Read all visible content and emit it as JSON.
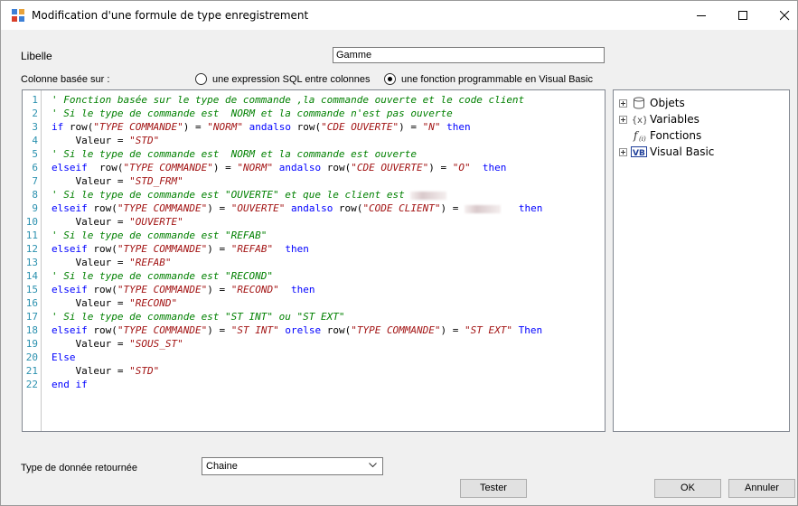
{
  "window": {
    "title": "Modification d'une formule de type enregistrement"
  },
  "form": {
    "libelle_label": "Libelle",
    "libelle_value": "Gamme",
    "colonne_label": "Colonne basée sur :",
    "radio_sql_label": "une expression SQL entre colonnes",
    "radio_vb_label": "une fonction programmable en Visual Basic",
    "radio_selected": "vb",
    "type_label": "Type de donnée retournée",
    "type_value": "Chaine"
  },
  "editor": {
    "line_numbers": [
      "1",
      "2",
      "3",
      "4",
      "5",
      "6",
      "7",
      "8",
      "9",
      "10",
      "11",
      "12",
      "13",
      "14",
      "15",
      "16",
      "17",
      "18",
      "19",
      "20",
      "21",
      "22"
    ],
    "lines": [
      [
        {
          "t": "' Fonction basée sur le type de commande ,la commande ouverte et le code client",
          "c": "comment"
        }
      ],
      [
        {
          "t": "' Si le type de commande est  NORM et la commande n'est pas ouverte",
          "c": "comment"
        }
      ],
      [
        {
          "t": "if",
          "c": "kw"
        },
        {
          "t": " row(",
          "c": "plain"
        },
        {
          "t": "\"TYPE COMMANDE\"",
          "c": "str"
        },
        {
          "t": ") = ",
          "c": "plain"
        },
        {
          "t": "\"NORM\"",
          "c": "str"
        },
        {
          "t": " ",
          "c": "plain"
        },
        {
          "t": "andalso",
          "c": "kw"
        },
        {
          "t": " row(",
          "c": "plain"
        },
        {
          "t": "\"CDE OUVERTE\"",
          "c": "str"
        },
        {
          "t": ") = ",
          "c": "plain"
        },
        {
          "t": "\"N\"",
          "c": "str"
        },
        {
          "t": " ",
          "c": "plain"
        },
        {
          "t": "then",
          "c": "kw"
        }
      ],
      [
        {
          "t": "    Valeur = ",
          "c": "plain"
        },
        {
          "t": "\"STD\"",
          "c": "str"
        }
      ],
      [
        {
          "t": "' Si le type de commande est  NORM et la commande est ouverte",
          "c": "comment"
        }
      ],
      [
        {
          "t": "elseif",
          "c": "kw"
        },
        {
          "t": "  row(",
          "c": "plain"
        },
        {
          "t": "\"TYPE COMMANDE\"",
          "c": "str"
        },
        {
          "t": ") = ",
          "c": "plain"
        },
        {
          "t": "\"NORM\"",
          "c": "str"
        },
        {
          "t": " ",
          "c": "plain"
        },
        {
          "t": "andalso",
          "c": "kw"
        },
        {
          "t": " row(",
          "c": "plain"
        },
        {
          "t": "\"CDE OUVERTE\"",
          "c": "str"
        },
        {
          "t": ") = ",
          "c": "plain"
        },
        {
          "t": "\"O\"",
          "c": "str"
        },
        {
          "t": "  ",
          "c": "plain"
        },
        {
          "t": "then",
          "c": "kw"
        }
      ],
      [
        {
          "t": "    Valeur = ",
          "c": "plain"
        },
        {
          "t": "\"STD_FRM\"",
          "c": "str"
        }
      ],
      [
        {
          "t": "' Si le type de commande est \"OUVERTE\" et que le client est ",
          "c": "comment"
        },
        {
          "t": "",
          "c": "blur"
        }
      ],
      [
        {
          "t": "elseif",
          "c": "kw"
        },
        {
          "t": " row(",
          "c": "plain"
        },
        {
          "t": "\"TYPE COMMANDE\"",
          "c": "str"
        },
        {
          "t": ") = ",
          "c": "plain"
        },
        {
          "t": "\"OUVERTE\"",
          "c": "str"
        },
        {
          "t": " ",
          "c": "plain"
        },
        {
          "t": "andalso",
          "c": "kw"
        },
        {
          "t": " row(",
          "c": "plain"
        },
        {
          "t": "\"CODE CLIENT\"",
          "c": "str"
        },
        {
          "t": ") = ",
          "c": "plain"
        },
        {
          "t": "",
          "c": "blur"
        },
        {
          "t": "   ",
          "c": "plain"
        },
        {
          "t": "then",
          "c": "kw"
        }
      ],
      [
        {
          "t": "    Valeur = ",
          "c": "plain"
        },
        {
          "t": "\"OUVERTE\"",
          "c": "str"
        }
      ],
      [
        {
          "t": "' Si le type de commande est \"REFAB\"",
          "c": "comment"
        }
      ],
      [
        {
          "t": "elseif",
          "c": "kw"
        },
        {
          "t": " row(",
          "c": "plain"
        },
        {
          "t": "\"TYPE COMMANDE\"",
          "c": "str"
        },
        {
          "t": ") = ",
          "c": "plain"
        },
        {
          "t": "\"REFAB\"",
          "c": "str"
        },
        {
          "t": "  ",
          "c": "plain"
        },
        {
          "t": "then",
          "c": "kw"
        }
      ],
      [
        {
          "t": "    Valeur = ",
          "c": "plain"
        },
        {
          "t": "\"REFAB\"",
          "c": "str"
        }
      ],
      [
        {
          "t": "' Si le type de commande est \"RECOND\"",
          "c": "comment"
        }
      ],
      [
        {
          "t": "elseif",
          "c": "kw"
        },
        {
          "t": " row(",
          "c": "plain"
        },
        {
          "t": "\"TYPE COMMANDE\"",
          "c": "str"
        },
        {
          "t": ") = ",
          "c": "plain"
        },
        {
          "t": "\"RECOND\"",
          "c": "str"
        },
        {
          "t": "  ",
          "c": "plain"
        },
        {
          "t": "then",
          "c": "kw"
        }
      ],
      [
        {
          "t": "    Valeur = ",
          "c": "plain"
        },
        {
          "t": "\"RECOND\"",
          "c": "str"
        }
      ],
      [
        {
          "t": "' Si le type de commande est \"ST INT\" ou \"ST EXT\"",
          "c": "comment"
        }
      ],
      [
        {
          "t": "elseif",
          "c": "kw"
        },
        {
          "t": " row(",
          "c": "plain"
        },
        {
          "t": "\"TYPE COMMANDE\"",
          "c": "str"
        },
        {
          "t": ") = ",
          "c": "plain"
        },
        {
          "t": "\"ST INT\"",
          "c": "str"
        },
        {
          "t": " ",
          "c": "plain"
        },
        {
          "t": "orelse",
          "c": "kw"
        },
        {
          "t": " row(",
          "c": "plain"
        },
        {
          "t": "\"TYPE COMMANDE\"",
          "c": "str"
        },
        {
          "t": ") = ",
          "c": "plain"
        },
        {
          "t": "\"ST EXT\"",
          "c": "str"
        },
        {
          "t": " ",
          "c": "plain"
        },
        {
          "t": "Then",
          "c": "kw"
        }
      ],
      [
        {
          "t": "    Valeur = ",
          "c": "plain"
        },
        {
          "t": "\"SOUS_ST\"",
          "c": "str"
        }
      ],
      [
        {
          "t": "Else",
          "c": "kw"
        }
      ],
      [
        {
          "t": "    Valeur = ",
          "c": "plain"
        },
        {
          "t": "\"STD\"",
          "c": "str"
        }
      ],
      [
        {
          "t": "end if",
          "c": "kw"
        }
      ]
    ]
  },
  "tree": {
    "items": [
      {
        "label": "Objets",
        "icon": "database-icon",
        "expandable": true
      },
      {
        "label": "Variables",
        "icon": "variable-icon",
        "expandable": true
      },
      {
        "label": "Fonctions",
        "icon": "function-icon",
        "expandable": false
      },
      {
        "label": "Visual Basic",
        "icon": "vb-icon",
        "expandable": true
      }
    ]
  },
  "buttons": {
    "tester": "Tester",
    "ok": "OK",
    "annuler": "Annuler"
  },
  "colors": {
    "comment": "#008000",
    "keyword": "#0000ff",
    "string": "#a31515",
    "line_number": "#2b91af"
  }
}
